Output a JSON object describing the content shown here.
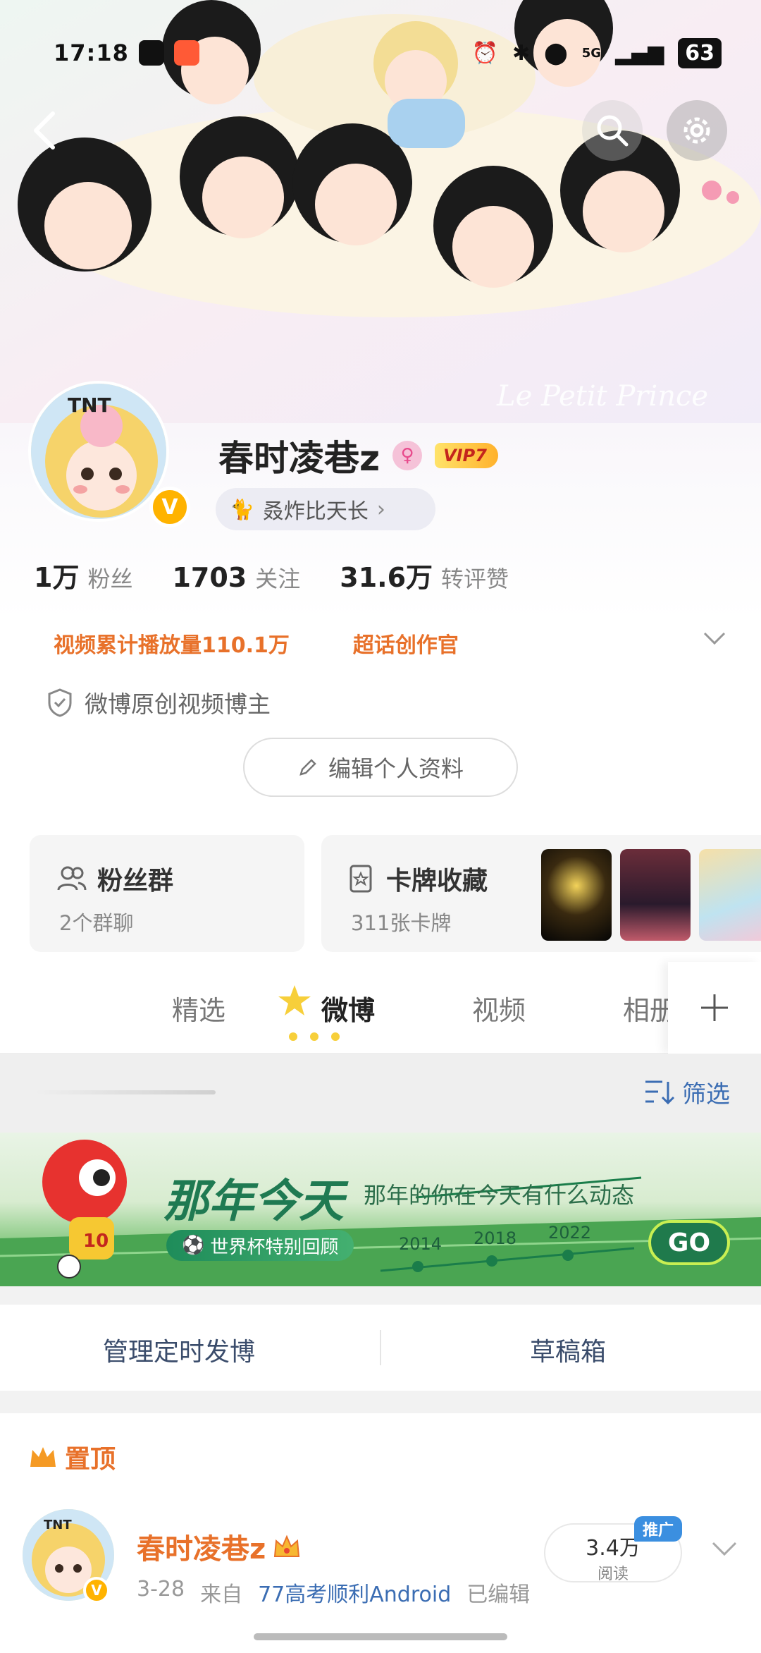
{
  "status_bar": {
    "time": "17:18",
    "network": "5G",
    "battery": "63"
  },
  "profile": {
    "username": "春时凌巷z",
    "vip_label": "VIP7",
    "bio": "叒炸比天长",
    "stats": [
      {
        "num": "1万",
        "label": "粉丝"
      },
      {
        "num": "1703",
        "label": "关注"
      },
      {
        "num": "31.6万",
        "label": "转评赞"
      }
    ],
    "highlights": [
      "视频累计播放量110.1万",
      "超话创作官"
    ],
    "certification": "微博原创视频博主",
    "edit_button": "编辑个人资料"
  },
  "cards": {
    "fans_group": {
      "title": "粉丝群",
      "sub": "2个群聊"
    },
    "card_collection": {
      "title": "卡牌收藏",
      "sub": "311张卡牌"
    }
  },
  "tabs": {
    "selected": "精选",
    "weibo": "微博",
    "video": "视频",
    "photo": "相册"
  },
  "filter": {
    "label": "筛选"
  },
  "promo": {
    "title": "那年今天",
    "subtitle": "那年的你在今天有什么动态",
    "tag": "世界杯特别回顾",
    "years": [
      "2014",
      "2018",
      "2022"
    ],
    "go": "GO"
  },
  "actions": {
    "scheduled": "管理定时发博",
    "drafts": "草稿箱"
  },
  "pinned_post": {
    "pin_label": "置顶",
    "author": "春时凌巷z",
    "date": "3-28",
    "from_label": "来自",
    "source": "77高考顺利Android",
    "edited": "已编辑",
    "read_count": "3.4万",
    "read_label": "阅读",
    "promo_badge": "推广"
  },
  "colors": {
    "accent_orange": "#e8712a",
    "link_blue": "#3b6db3",
    "vip_gold": "#ffb12b"
  }
}
